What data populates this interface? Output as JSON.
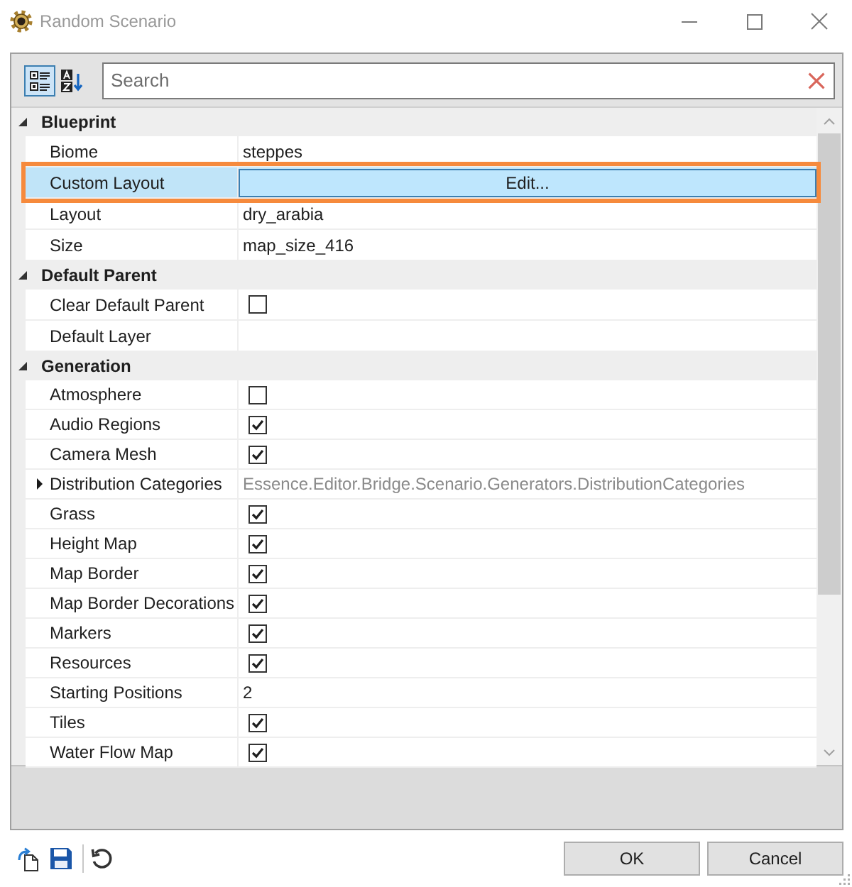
{
  "window": {
    "title": "Random Scenario"
  },
  "view_buttons": [
    {
      "kind": "categorized",
      "selected": true
    },
    {
      "kind": "alphabetical",
      "selected": false
    }
  ],
  "search": {
    "placeholder": "Search"
  },
  "categories": [
    {
      "name": "Blueprint",
      "expanded": true,
      "properties": [
        {
          "name": "Biome",
          "kind": "text",
          "value": "steppes",
          "selected": false,
          "highlighted": false
        },
        {
          "name": "Custom Layout",
          "kind": "button",
          "value": "Edit...",
          "selected": true,
          "highlighted": true
        },
        {
          "name": "Layout",
          "kind": "text",
          "value": "dry_arabia",
          "selected": false,
          "highlighted": false
        },
        {
          "name": "Size",
          "kind": "text",
          "value": "map_size_416",
          "selected": false,
          "highlighted": false
        }
      ]
    },
    {
      "name": "Default Parent",
      "expanded": true,
      "properties": [
        {
          "name": "Clear Default Parent",
          "kind": "checkbox",
          "checked": false,
          "selected": false,
          "highlighted": false
        },
        {
          "name": "Default Layer",
          "kind": "text",
          "selected": false,
          "highlighted": false
        }
      ]
    },
    {
      "name": "Generation",
      "expanded": true,
      "properties": [
        {
          "name": "Atmosphere",
          "kind": "checkbox",
          "checked": false,
          "selected": false,
          "highlighted": false
        },
        {
          "name": "Audio Regions",
          "kind": "checkbox",
          "checked": true,
          "selected": false,
          "highlighted": false
        },
        {
          "name": "Camera Mesh",
          "kind": "checkbox",
          "checked": true,
          "selected": false,
          "highlighted": false
        },
        {
          "name": "Distribution Categories",
          "kind": "object",
          "expanded": false,
          "value": "Essence.Editor.Bridge.Scenario.Generators.DistributionCategories",
          "selected": false,
          "highlighted": false
        },
        {
          "name": "Grass",
          "kind": "checkbox",
          "checked": true,
          "selected": false,
          "highlighted": false
        },
        {
          "name": "Height Map",
          "kind": "checkbox",
          "checked": true,
          "selected": false,
          "highlighted": false
        },
        {
          "name": "Map Border",
          "kind": "checkbox",
          "checked": true,
          "selected": false,
          "highlighted": false
        },
        {
          "name": "Map Border Decorations",
          "kind": "checkbox",
          "checked": true,
          "selected": false,
          "highlighted": false
        },
        {
          "name": "Markers",
          "kind": "checkbox",
          "checked": true,
          "selected": false,
          "highlighted": false
        },
        {
          "name": "Resources",
          "kind": "checkbox",
          "checked": true,
          "selected": false,
          "highlighted": false
        },
        {
          "name": "Starting Positions",
          "kind": "text",
          "value": "2",
          "selected": false,
          "highlighted": false
        },
        {
          "name": "Tiles",
          "kind": "checkbox",
          "checked": true,
          "selected": false,
          "highlighted": false
        },
        {
          "name": "Water Flow Map",
          "kind": "checkbox",
          "checked": true,
          "selected": false,
          "highlighted": false
        }
      ]
    }
  ],
  "buttons": [
    {
      "label": "OK"
    },
    {
      "label": "Cancel"
    }
  ]
}
